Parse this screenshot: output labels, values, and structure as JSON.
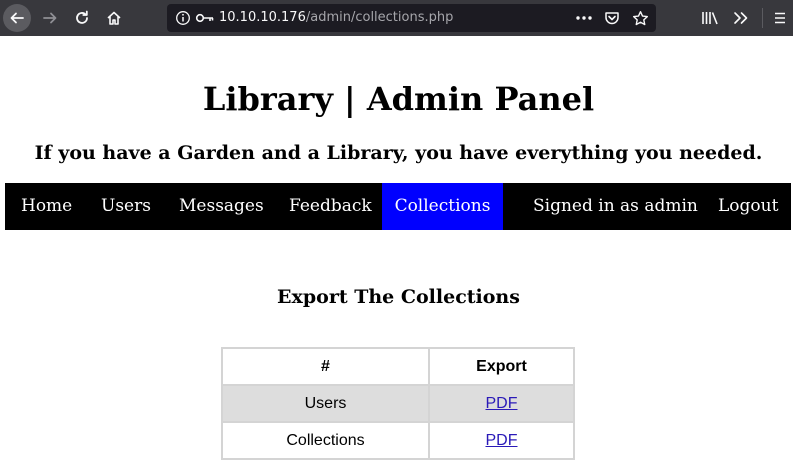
{
  "browser": {
    "url_host": "10.10.10.176",
    "url_path": "/admin/collections.php",
    "icons": {
      "back": "back-arrow-icon",
      "forward": "forward-arrow-icon",
      "reload": "reload-icon",
      "home": "home-icon",
      "info": "info-icon",
      "key": "key-icon",
      "more": "more-dots-icon",
      "pocket": "pocket-icon",
      "bookmark": "star-icon",
      "library": "library-icon",
      "overflow": "double-chevron-icon",
      "menu": "hamburger-menu-icon"
    }
  },
  "header": {
    "title": "Library | Admin Panel",
    "tagline": "If you have a Garden and a Library, you have everything you needed."
  },
  "nav": {
    "items": [
      {
        "label": "Home"
      },
      {
        "label": "Users"
      },
      {
        "label": "Messages"
      },
      {
        "label": "Feedback"
      },
      {
        "label": "Collections",
        "active": true
      }
    ],
    "signed_in": "Signed in as admin",
    "logout": "Logout",
    "active_color": "#0000ff",
    "bar_color": "#000000"
  },
  "main": {
    "heading": "Export The Collections",
    "table": {
      "headers": [
        "#",
        "Export"
      ],
      "rows": [
        {
          "name": "Users",
          "export": "PDF"
        },
        {
          "name": "Collections",
          "export": "PDF"
        }
      ]
    }
  }
}
